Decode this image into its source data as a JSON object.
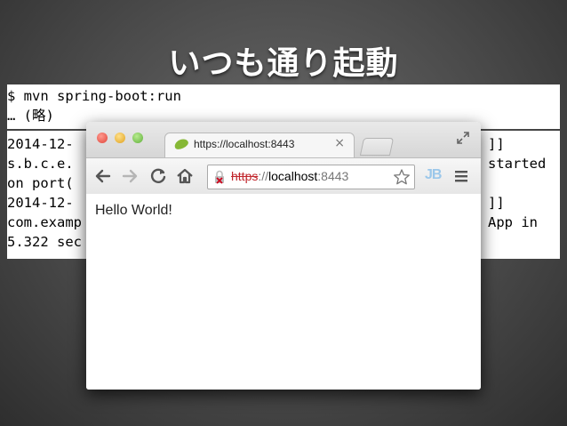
{
  "slide": {
    "title": "いつも通り起動"
  },
  "terminal": {
    "command": "$ mvn spring-boot:run",
    "omitted": "… (略)",
    "lines": [
      {
        "left": "2014-12-",
        "right": "]]"
      },
      {
        "left": "s.b.c.e.",
        "right": "started"
      },
      {
        "left": "on port(",
        "right": ""
      },
      {
        "left": "2014-12-",
        "right": "]]"
      },
      {
        "left": "com.examp",
        "right": "App in"
      },
      {
        "left": "5.322 sec",
        "right": ""
      }
    ]
  },
  "browser": {
    "tab": {
      "title": "https://localhost:8443",
      "close_glyph": "×",
      "favicon": "spring-leaf-icon"
    },
    "omnibox": {
      "scheme": "https",
      "separator": "://",
      "host": "localhost",
      "port": ":8443",
      "security_state": "ssl-error-lock-icon"
    },
    "extension_label": "JB",
    "page": {
      "text": "Hello World!"
    }
  },
  "colors": {
    "scheme_error": "#c1272d",
    "spring_green": "#86b836",
    "jb_blue": "#9bc7ea"
  }
}
